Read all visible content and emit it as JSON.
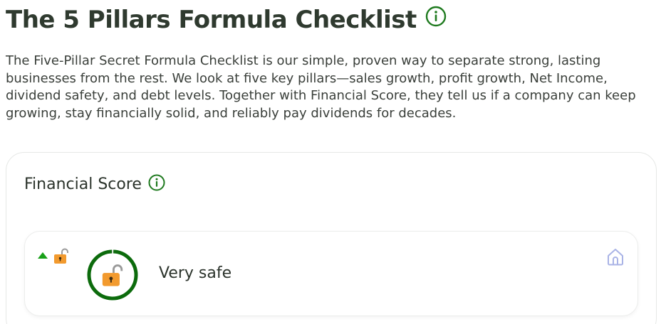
{
  "page": {
    "title": "The 5 Pillars Formula Checklist",
    "intro": "The Five-Pillar Secret Formula Checklist is our simple, proven way to separate strong, lasting businesses from the rest. We look at five key pillars—sales growth, profit growth, Net Income, dividend safety, and debt levels. Together with Financial Score, they tell us if a company can keep growing, stay financially solid, and reliably pay dividends for decades."
  },
  "financial_score": {
    "title": "Financial Score",
    "rating_label": "Very safe",
    "trend": "up",
    "gauge_fraction": 1.0
  },
  "colors": {
    "accent_green": "#1f7a1f",
    "gauge_green": "#0c6b0c",
    "trend_green": "#18a018",
    "lock_orange": "#f29a2e",
    "home_icon": "#a9b3e6",
    "title": "#2f3a2f"
  },
  "icons": {
    "title_info": "info-circle-icon",
    "card_info": "info-circle-icon",
    "trend": "triangle-up-icon",
    "small_lock": "unlocked-padlock-icon",
    "gauge_lock": "unlocked-padlock-icon",
    "home": "home-icon"
  }
}
